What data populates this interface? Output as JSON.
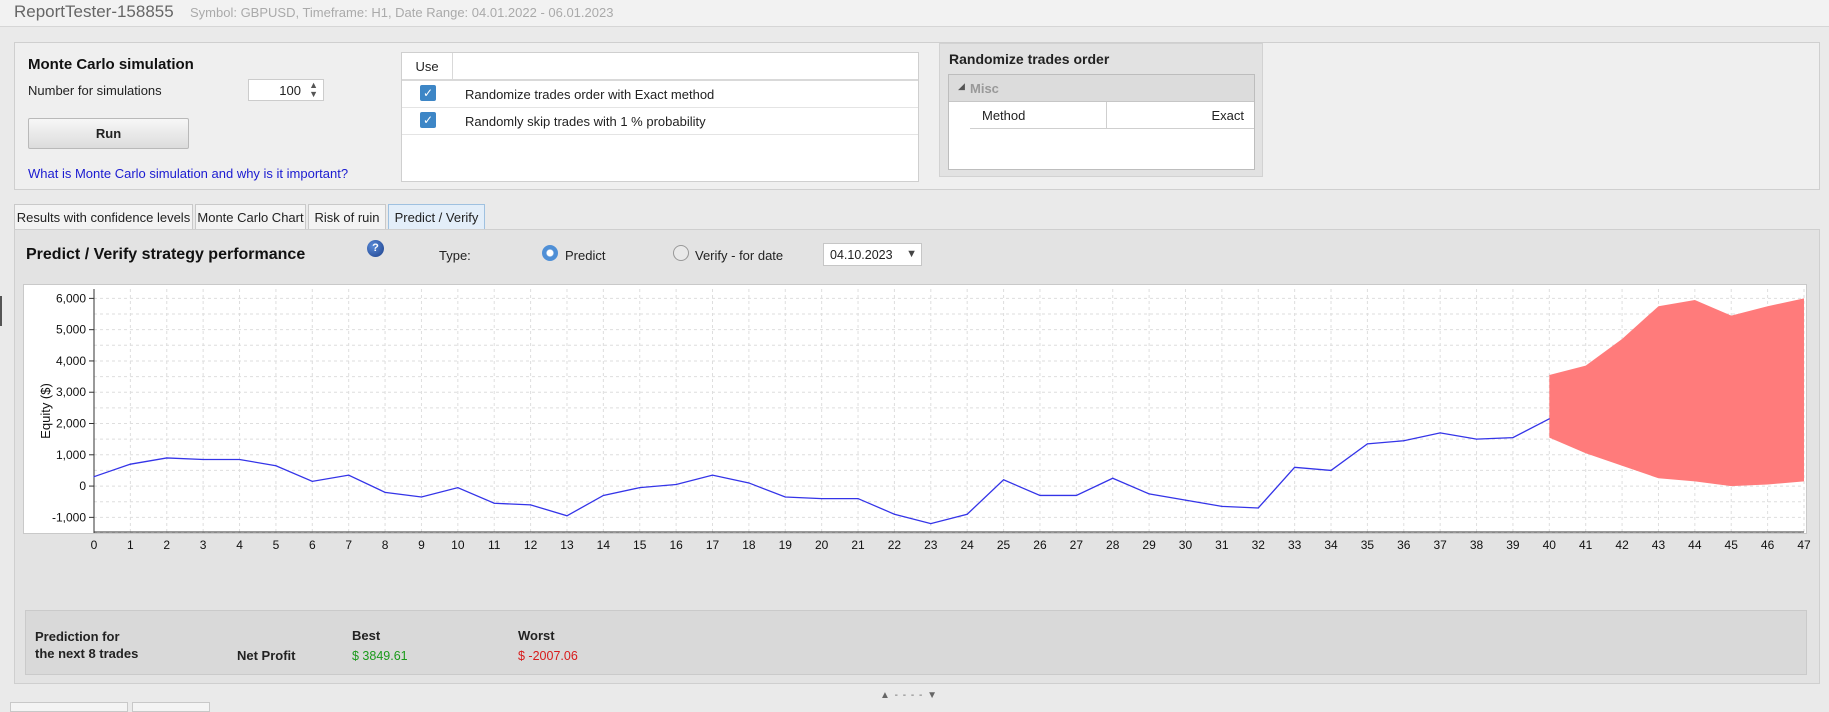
{
  "window": {
    "title": "ReportTester-158855",
    "meta": "Symbol: GBPUSD, Timeframe: H1, Date Range: 04.01.2022 - 06.01.2023"
  },
  "monte_carlo": {
    "title": "Monte Carlo simulation",
    "sim_label": "Number for simulations",
    "sim_value": "100",
    "run_label": "Run",
    "help_link": "What is Monte Carlo simulation and why is it important?"
  },
  "use_table": {
    "header": "Use",
    "rows": [
      {
        "text": "Randomize trades order with Exact method",
        "checked": true
      },
      {
        "text": "Randomly skip trades with 1 % probability",
        "checked": true
      }
    ]
  },
  "randomize": {
    "title": "Randomize trades order",
    "category": "Misc",
    "property": "Method",
    "value": "Exact"
  },
  "tabs": [
    {
      "label": "Results with confidence levels",
      "active": false
    },
    {
      "label": "Monte Carlo Chart",
      "active": false
    },
    {
      "label": "Risk of ruin",
      "active": false
    },
    {
      "label": "Predict / Verify",
      "active": true
    }
  ],
  "predict": {
    "title": "Predict / Verify strategy performance",
    "type_label": "Type:",
    "predict_label": "Predict",
    "verify_label": "Verify - for date",
    "date": "04.10.2023",
    "selected": "Predict"
  },
  "chart_data": {
    "type": "line",
    "ylabel": "Equity ($)",
    "xlabel": "",
    "ylim": [
      -1500,
      6300
    ],
    "xlim": [
      0,
      47
    ],
    "yticks": [
      -1000,
      0,
      1000,
      2000,
      3000,
      4000,
      5000,
      6000
    ],
    "ytick_labels": [
      "-1,000",
      "0",
      "1,000",
      "2,000",
      "3,000",
      "4,000",
      "5,000",
      "6,000"
    ],
    "grid": true,
    "x": [
      0,
      1,
      2,
      3,
      4,
      5,
      6,
      7,
      8,
      9,
      10,
      11,
      12,
      13,
      14,
      15,
      16,
      17,
      18,
      19,
      20,
      21,
      22,
      23,
      24,
      25,
      26,
      27,
      28,
      29,
      30,
      31,
      32,
      33,
      34,
      35,
      36,
      37,
      38,
      39,
      40
    ],
    "series": [
      {
        "values": [
          300,
          700,
          900,
          850,
          850,
          650,
          150,
          350,
          -200,
          -350,
          -50,
          -550,
          -600,
          -950,
          -300,
          -50,
          50,
          350,
          100,
          -350,
          -400,
          -400,
          -900,
          -1200,
          -900,
          200,
          -300,
          -300,
          250,
          -250,
          -450,
          -650,
          -700,
          600,
          500,
          1350,
          1450,
          1700,
          1500,
          1550,
          2150
        ],
        "color": "#3434e8"
      }
    ],
    "band": {
      "x": [
        40,
        41,
        42,
        43,
        44,
        45,
        46,
        47
      ],
      "upper": [
        3550,
        3850,
        4700,
        5750,
        5950,
        5450,
        5750,
        6000
      ],
      "lower": [
        1550,
        1050,
        650,
        250,
        150,
        0,
        50,
        150
      ],
      "color": "#ff7b7b"
    }
  },
  "prediction": {
    "label_line1": "Prediction for",
    "label_line2": "the next 8 trades",
    "net_profit_label": "Net Profit",
    "best_label": "Best",
    "worst_label": "Worst",
    "best_value": "$ 3849.61",
    "worst_value": "$ -2007.06"
  }
}
